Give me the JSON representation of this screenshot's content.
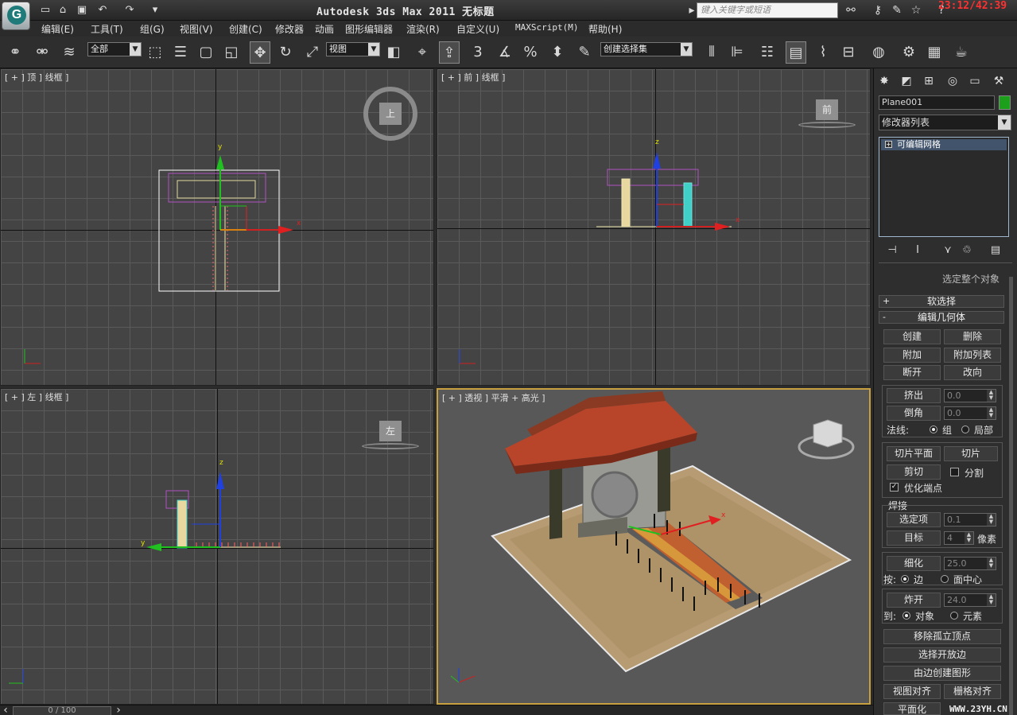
{
  "app": {
    "title": "Autodesk 3ds Max  2011        无标题",
    "search_placeholder": "键入关键字或短语",
    "clock": "23:12/42:39",
    "logo": "G"
  },
  "quick_access": [
    "new-file-icon",
    "open-file-icon",
    "save-icon",
    "undo-icon",
    "redo-icon",
    "dropdown-icon"
  ],
  "menu": [
    "编辑(E)",
    "工具(T)",
    "组(G)",
    "视图(V)",
    "创建(C)",
    "修改器",
    "动画",
    "图形编辑器",
    "渲染(R)",
    "自定义(U)",
    "MAXScript(M)",
    "帮助(H)"
  ],
  "toolbar": {
    "selection_filter": "全部",
    "ref_coord": "视图",
    "named_selection": "创建选择集",
    "snap_label": "3"
  },
  "viewports": {
    "top": {
      "label": "[ + ] 顶 ] 线框 ]",
      "cube": "上"
    },
    "front": {
      "label": "[ + ] 前 ] 线框 ]",
      "cube": "前"
    },
    "left": {
      "label": "[ + ] 左 ] 线框 ]",
      "cube": "左"
    },
    "persp": {
      "label": "[ + ] 透视 ] 平滑 + 高光 ]"
    }
  },
  "axis_labels": {
    "x": "x",
    "y": "y",
    "z": "z"
  },
  "command_panel": {
    "object_name": "Plane001",
    "object_color": "#1ca01c",
    "modifier_list": "修改器列表",
    "stack_item": "可编辑网格",
    "cut_text": "选定整个对象",
    "rollout_soft": "软选择",
    "rollout_edit_geo": "编辑几何体",
    "btn_create": "创建",
    "btn_delete": "删除",
    "btn_attach": "附加",
    "btn_attach_list": "附加列表",
    "btn_detach": "断开",
    "btn_turn": "改向",
    "btn_extrude": "挤出",
    "extrude_val": "0.0",
    "btn_bevel": "倒角",
    "bevel_val": "0.0",
    "normal_label": "法线:",
    "normal_group": "组",
    "normal_local": "局部",
    "btn_slice_plane": "切片平面",
    "btn_slice": "切片",
    "btn_cut": "剪切",
    "split_label": "分割",
    "optimize_label": "优化端点",
    "weld_label": "焊接",
    "btn_weld_sel": "选定项",
    "weld_sel_val": "0.1",
    "btn_weld_target": "目标",
    "weld_target_val": "4",
    "pixels_label": "像素",
    "btn_tessellate": "细化",
    "tess_val": "25.0",
    "by_label": "按:",
    "by_edge": "边",
    "by_face_center": "面中心",
    "btn_explode": "炸开",
    "explode_val": "24.0",
    "to_label": "到:",
    "to_objects": "对象",
    "to_elements": "元素",
    "btn_remove_iso": "移除孤立顶点",
    "btn_select_open": "选择开放边",
    "btn_create_shape": "由边创建图形",
    "btn_view_align": "视图对齐",
    "btn_grid_align": "栅格对齐",
    "btn_flatten": "平面化"
  },
  "timeline": {
    "frame": "0 / 100"
  },
  "watermark": "WWW.23YH.CN"
}
